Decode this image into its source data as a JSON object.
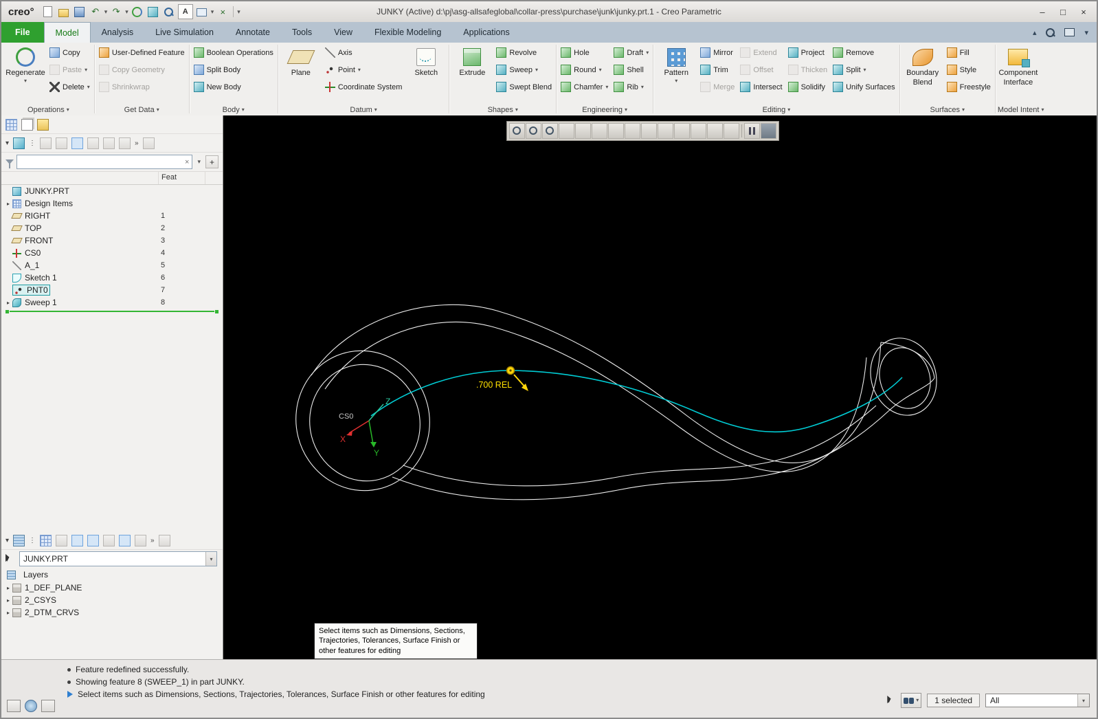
{
  "window": {
    "logo": "creo°",
    "title": "JUNKY (Active) d:\\pj\\asg-allsafeglobal\\collar-press\\purchase\\junk\\junky.prt.1 - Creo Parametric"
  },
  "icons": {
    "caret": "▾",
    "caret_up": "▴",
    "arrow_right": "▸",
    "close": "×",
    "minimize": "–",
    "maximize": "□",
    "overflow": "»",
    "dots": "⋮",
    "plus": "+",
    "clear": "×",
    "undo": "↶",
    "redo": "↷",
    "letter_a": "A"
  },
  "tabs": [
    "File",
    "Model",
    "Analysis",
    "Live Simulation",
    "Annotate",
    "Tools",
    "View",
    "Flexible Modeling",
    "Applications"
  ],
  "ribbon": {
    "operations": {
      "big": "Regenerate",
      "items": [
        "Copy",
        "Paste",
        "Delete"
      ],
      "footer": "Operations"
    },
    "get_data": {
      "items": [
        "User-Defined Feature",
        "Copy Geometry",
        "Shrinkwrap"
      ],
      "footer": "Get Data"
    },
    "body": {
      "items": [
        "Boolean Operations",
        "Split Body",
        "New Body"
      ],
      "footer": "Body"
    },
    "datum": {
      "big1": "Plane",
      "items": [
        "Axis",
        "Point",
        "Coordinate System"
      ],
      "big2": "Sketch",
      "footer": "Datum"
    },
    "shapes": {
      "big": "Extrude",
      "items": [
        "Revolve",
        "Sweep",
        "Swept Blend"
      ],
      "footer": "Shapes"
    },
    "engineering": {
      "col1": [
        "Hole",
        "Round",
        "Chamfer"
      ],
      "col2": [
        "Draft",
        "Shell",
        "Rib"
      ],
      "footer": "Engineering"
    },
    "editing": {
      "big": "Pattern",
      "col1": [
        "Mirror",
        "Trim",
        "Merge"
      ],
      "col2": [
        "Extend",
        "Offset",
        "Intersect"
      ],
      "col3": [
        "Project",
        "Thicken",
        "Solidify"
      ],
      "col4": [
        "Remove",
        "Split",
        "Unify Surfaces"
      ],
      "footer": "Editing"
    },
    "surfaces": {
      "big_line1": "Boundary",
      "big_line2": "Blend",
      "items": [
        "Fill",
        "Style",
        "Freestyle"
      ],
      "footer": "Surfaces"
    },
    "model_intent": {
      "big_line1": "Component",
      "big_line2": "Interface",
      "footer": "Model Intent"
    }
  },
  "model_tree": {
    "root": "JUNKY.PRT",
    "column_header": "Feat",
    "items": [
      {
        "label": "Design Items",
        "num": ""
      },
      {
        "label": "RIGHT",
        "num": "1"
      },
      {
        "label": "TOP",
        "num": "2"
      },
      {
        "label": "FRONT",
        "num": "3"
      },
      {
        "label": "CS0",
        "num": "4"
      },
      {
        "label": "A_1",
        "num": "5"
      },
      {
        "label": "Sketch 1",
        "num": "6"
      },
      {
        "label": "PNT0",
        "num": "7"
      },
      {
        "label": "Sweep 1",
        "num": "8"
      }
    ]
  },
  "layers": {
    "combo_value": "JUNKY.PRT",
    "title": "Layers",
    "items": [
      "1_DEF_PLANE",
      "2_CSYS",
      "2_DTM_CRVS"
    ]
  },
  "viewport": {
    "dim_label": ".700 REL",
    "csys_label": "CS0",
    "axis_x": "X",
    "axis_y": "Y",
    "axis_z": "Z",
    "tooltip": "Select items such as Dimensions, Sections, Trajectories, Tolerances, Surface Finish or other features for editing"
  },
  "statusbar": {
    "msg1": "Feature redefined successfully.",
    "msg2": "Showing feature 8 (SWEEP_1) in part JUNKY.",
    "msg3": "Select items such as Dimensions, Sections, Trajectories, Tolerances, Surface Finish or other features for editing",
    "selected": "1 selected",
    "filter_value": "All"
  },
  "colors": {
    "creo_green": "#2fa02f",
    "trajectory_cyan": "#00ccd4",
    "highlight_yellow": "#ffd60a",
    "canvas_bg": "#000000",
    "wireframe": "#ededed"
  }
}
